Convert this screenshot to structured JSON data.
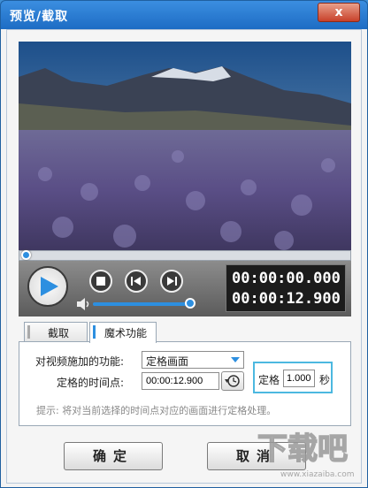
{
  "window": {
    "title": "预览/截取",
    "close_label": "x"
  },
  "player": {
    "current_time": "00:00:00.000",
    "total_time": "00:00:12.900"
  },
  "tabs": [
    {
      "label": "截取",
      "active": false
    },
    {
      "label": "魔术功能",
      "active": true
    }
  ],
  "magic": {
    "function_label": "对视频施加的功能:",
    "function_value": "定格画面",
    "timepoint_label": "定格的时间点:",
    "timepoint_value": "00:00:12.900",
    "freeze_label": "定格",
    "freeze_value": "1.000",
    "freeze_unit": "秒"
  },
  "hint": "提示: 将对当前选择的时间点对应的画面进行定格处理。",
  "buttons": {
    "ok": "确定",
    "cancel": "取消"
  },
  "watermark": {
    "text": "下载吧",
    "url": "www.xiazaiba.com"
  },
  "colors": {
    "accent": "#2d8fe0",
    "highlight": "#4cb8e0"
  }
}
